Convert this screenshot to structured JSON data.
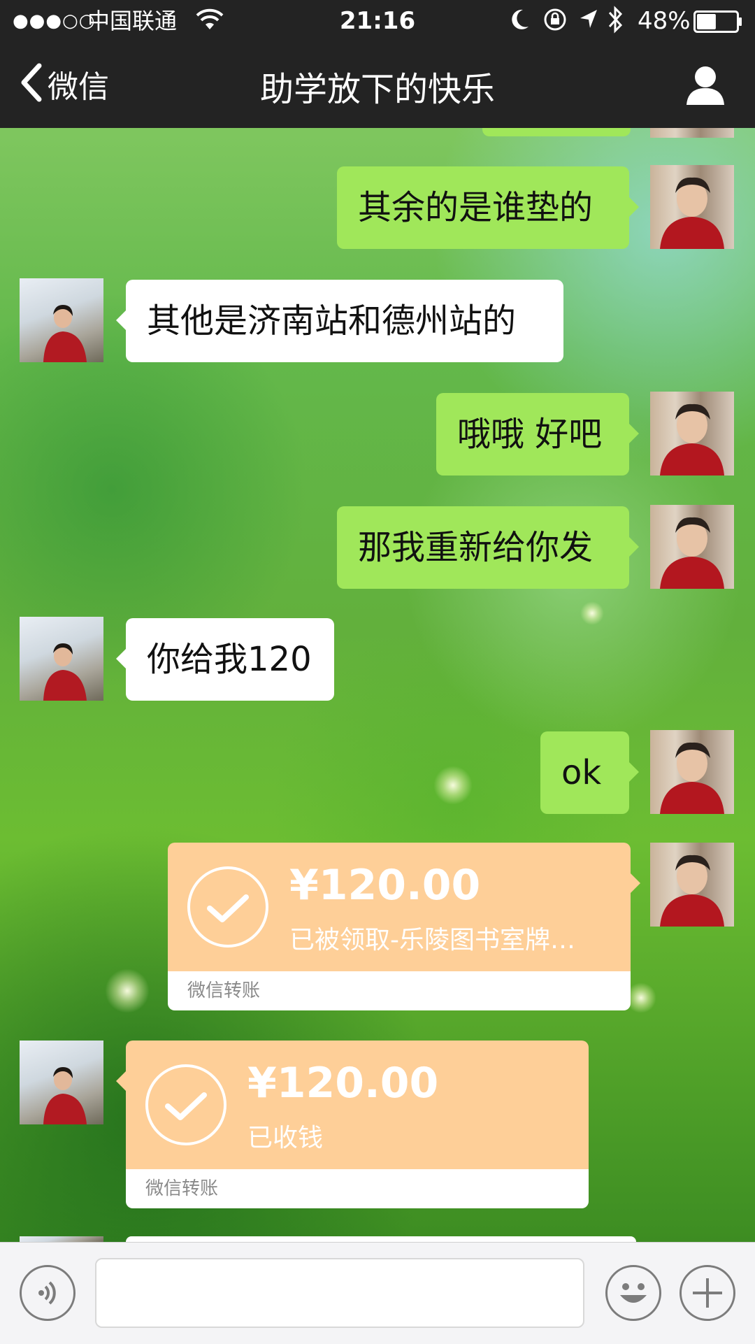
{
  "status_bar": {
    "signal": "●●●○○",
    "carrier": "中国联通",
    "time": "21:16",
    "battery": "48%",
    "battery_level": 0.48
  },
  "nav": {
    "back_label": "微信",
    "title": "助学放下的快乐"
  },
  "messages": [
    {
      "from": "me",
      "type": "text",
      "text": "其余的是谁垫的"
    },
    {
      "from": "other",
      "type": "text",
      "text": "其他是济南站和德州站的"
    },
    {
      "from": "me",
      "type": "text",
      "text": "哦哦 好吧"
    },
    {
      "from": "me",
      "type": "text",
      "text": "那我重新给你发"
    },
    {
      "from": "other",
      "type": "text",
      "text": "你给我120"
    },
    {
      "from": "me",
      "type": "text",
      "text": "ok"
    },
    {
      "from": "me",
      "type": "transfer",
      "amount": "¥120.00",
      "status": "已被领取-乐陵图书室牌…",
      "footer": "微信转账"
    },
    {
      "from": "other",
      "type": "transfer",
      "amount": "¥120.00",
      "status": "已收钱",
      "footer": "微信转账"
    }
  ],
  "input_bar": {
    "voice_icon": "voice-icon",
    "emoji_icon": "emoji-icon",
    "plus_icon": "plus-icon",
    "input_value": ""
  },
  "colors": {
    "nav_bg": "#232323",
    "my_bubble": "#a0e75a",
    "their_bubble": "#ffffff",
    "transfer": "#fecf98"
  }
}
